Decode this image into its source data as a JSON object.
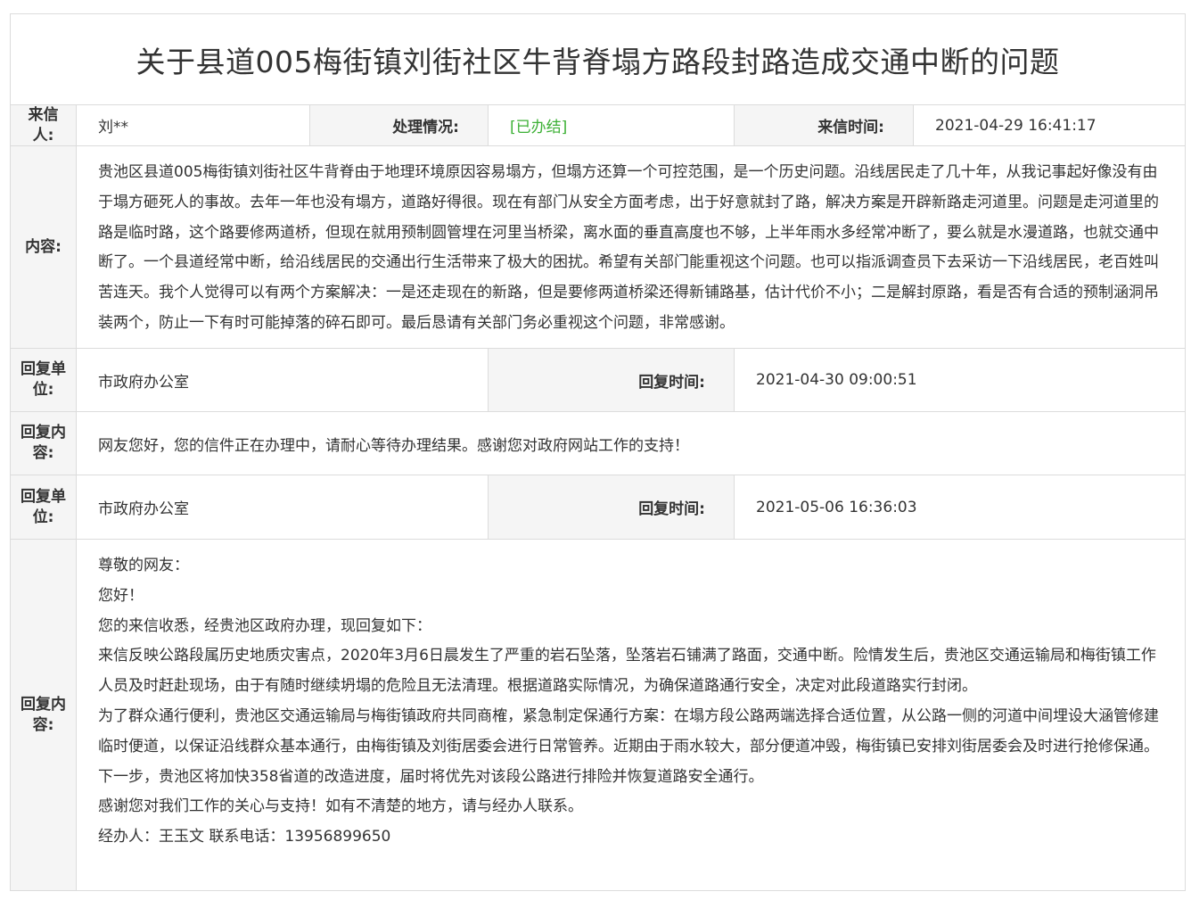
{
  "title": "关于县道005梅街镇刘街社区牛背脊塌方路段封路造成交通中断的问题",
  "labels": {
    "sender": "来信人:",
    "status": "处理情况:",
    "time": "来信时间:",
    "content": "内容:",
    "reply_unit": "回复单位:",
    "reply_time": "回复时间:",
    "reply_content": "回复内容:"
  },
  "letter": {
    "sender": "刘**",
    "status": "[已办结]",
    "time": "2021-04-29 16:41:17",
    "content": "贵池区县道005梅街镇刘街社区牛背脊由于地理环境原因容易塌方，但塌方还算一个可控范围，是一个历史问题。沿线居民走了几十年，从我记事起好像没有由于塌方砸死人的事故。去年一年也没有塌方，道路好得很。现在有部门从安全方面考虑，出于好意就封了路，解决方案是开辟新路走河道里。问题是走河道里的路是临时路，这个路要修两道桥，但现在就用预制圆管埋在河里当桥梁，离水面的垂直高度也不够，上半年雨水多经常冲断了，要么就是水漫道路，也就交通中断了。一个县道经常中断，给沿线居民的交通出行生活带来了极大的困扰。希望有关部门能重视这个问题。也可以指派调查员下去采访一下沿线居民，老百姓叫苦连天。我个人觉得可以有两个方案解决：一是还走现在的新路，但是要修两道桥梁还得新铺路基，估计代价不小；二是解封原路，看是否有合适的预制涵洞吊装两个，防止一下有时可能掉落的碎石即可。最后恳请有关部门务必重视这个问题，非常感谢。"
  },
  "replies": [
    {
      "unit": "市政府办公室",
      "time": "2021-04-30 09:00:51",
      "content": [
        "网友您好，您的信件正在办理中，请耐心等待办理结果。感谢您对政府网站工作的支持！"
      ]
    },
    {
      "unit": "市政府办公室",
      "time": "2021-05-06 16:36:03",
      "content": [
        "尊敬的网友：",
        "您好！",
        "您的来信收悉，经贵池区政府办理，现回复如下：",
        "来信反映公路段属历史地质灾害点，2020年3月6日晨发生了严重的岩石坠落，坠落岩石铺满了路面，交通中断。险情发生后，贵池区交通运输局和梅街镇工作人员及时赶赴现场，由于有随时继续坍塌的危险且无法清理。根据道路实际情况，为确保道路通行安全，决定对此段道路实行封闭。",
        "为了群众通行便利，贵池区交通运输局与梅街镇政府共同商榷，紧急制定保通行方案：在塌方段公路两端选择合适位置，从公路一侧的河道中间埋设大涵管修建临时便道，以保证沿线群众基本通行，由梅街镇及刘街居委会进行日常管养。近期由于雨水较大，部分便道冲毁，梅街镇已安排刘街居委会及时进行抢修保通。",
        "下一步，贵池区将加快358省道的改造进度，届时将优先对该段公路进行排险并恢复道路安全通行。",
        "感谢您对我们工作的关心与支持！如有不清楚的地方，请与经办人联系。",
        "经办人：王玉文 联系电话：13956899650"
      ]
    }
  ],
  "colors": {
    "status": "#3cb035",
    "label_bg": "#f5f5f5",
    "border": "#dcdcdc"
  }
}
